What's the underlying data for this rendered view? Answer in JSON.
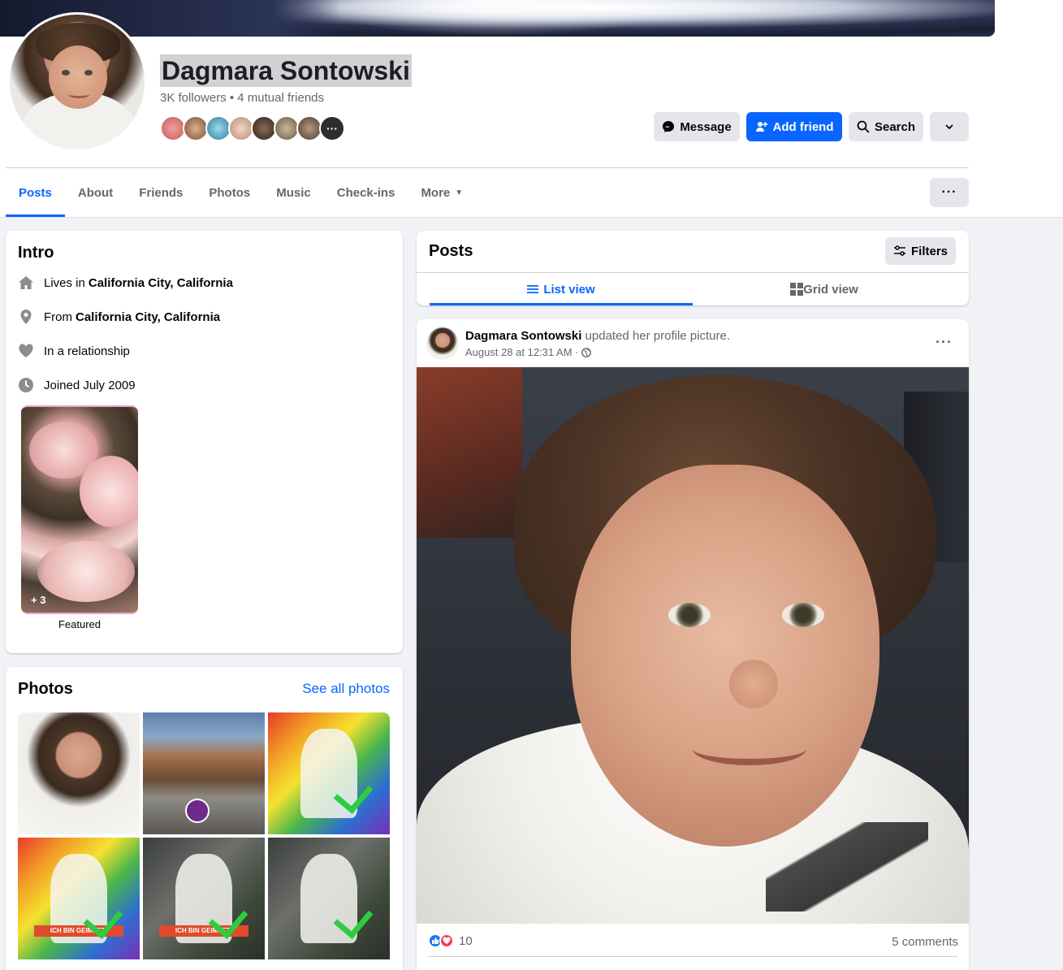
{
  "profile": {
    "name": "Dagmara Sontowski",
    "stats": "3K followers • 4 mutual friends",
    "friend_avatar_colors": [
      "#d86b6b",
      "#9b6b4e",
      "#3aa6c9",
      "#e0b49a",
      "#6b4a3a",
      "#a08a6a",
      "#7a6a55"
    ],
    "more_friends_label": "···"
  },
  "actions": {
    "message": "Message",
    "add_friend": "Add friend",
    "search": "Search"
  },
  "tabs": [
    {
      "label": "Posts"
    },
    {
      "label": "About"
    },
    {
      "label": "Friends"
    },
    {
      "label": "Photos"
    },
    {
      "label": "Music"
    },
    {
      "label": "Check-ins"
    },
    {
      "label": "More"
    }
  ],
  "tabs_more_button": "···",
  "intro": {
    "title": "Intro",
    "lives_prefix": "Lives in",
    "lives_place": "California City, California",
    "from_prefix": "From",
    "from_place": "California City, California",
    "relationship": "In a relationship",
    "joined": "Joined July 2009",
    "featured_count": "+ 3",
    "featured_label": "Featured"
  },
  "photos": {
    "title": "Photos",
    "see_all": "See all photos",
    "banner_text": "ICH BIN GEIMPFT!"
  },
  "posts_header": {
    "title": "Posts",
    "filters": "Filters",
    "list_view": "List view",
    "grid_view": "Grid view"
  },
  "post": {
    "author": "Dagmara Sontowski",
    "action": "updated her profile picture.",
    "timestamp": "August 28 at 12:31 AM ·",
    "menu": "···",
    "reaction_count": "10",
    "comments": "5 comments"
  },
  "colors": {
    "accent": "#0866ff",
    "secondary_text": "#65676b",
    "button_gray": "#e4e6eb"
  }
}
